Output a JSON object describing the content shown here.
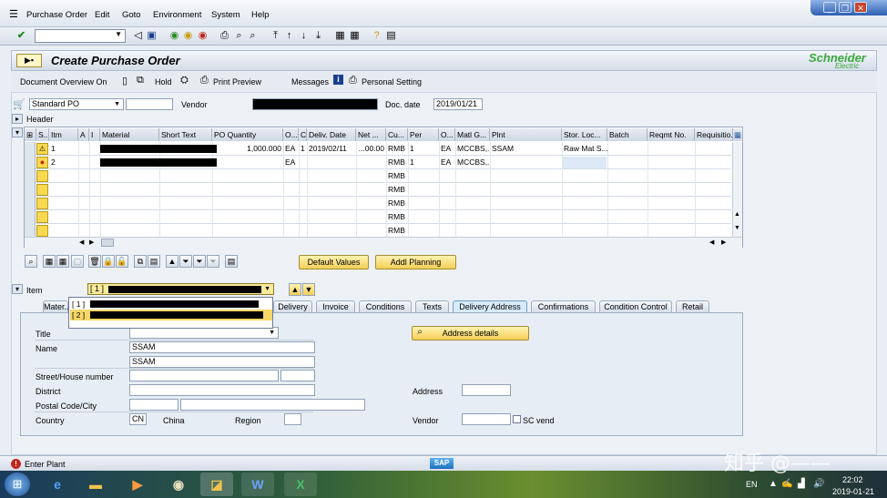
{
  "menu": {
    "items": [
      "Purchase Order",
      "Edit",
      "Goto",
      "Environment",
      "System",
      "Help"
    ]
  },
  "title": "Create Purchase Order",
  "brand": {
    "top": "Schneider",
    "bottom": "Electric"
  },
  "app_toolbar": {
    "doc_overview": "Document Overview On",
    "hold": "Hold",
    "print_preview": "Print Preview",
    "messages": "Messages",
    "personal_setting": "Personal Setting"
  },
  "header": {
    "doc_type": "Standard PO",
    "vendor_label": "Vendor",
    "doc_date_label": "Doc. date",
    "doc_date": "2019/01/21",
    "header_label": "Header"
  },
  "grid": {
    "columns": [
      "S..",
      "Itm",
      "A",
      "I",
      "Material",
      "Short Text",
      "PO Quantity",
      "O...",
      "C",
      "Deliv. Date",
      "Net ...",
      "Cu...",
      "Per",
      "O...",
      "Matl G...",
      "Plnt",
      "Stor. Loc...",
      "Batch",
      "Reqmt No.",
      "Requisitio..."
    ],
    "rows": [
      {
        "status": "warning",
        "itm": "1",
        "qty": "1,000.000",
        "unit": "EA",
        "c": "1",
        "date": "2019/02/11",
        "net": "...00.00",
        "cur": "RMB",
        "per": "1",
        "oun": "EA",
        "matlg": "MCCBS,...",
        "plnt": "SSAM",
        "sloc": "Raw Mat S..."
      },
      {
        "status": "error",
        "itm": "2",
        "qty": "",
        "unit": "EA",
        "c": "",
        "date": "",
        "net": "",
        "cur": "RMB",
        "per": "1",
        "oun": "EA",
        "matlg": "MCCBS,...",
        "plnt": "",
        "sloc": ""
      },
      {
        "status": "",
        "itm": "",
        "qty": "",
        "unit": "",
        "c": "",
        "date": "",
        "net": "",
        "cur": "RMB",
        "per": "",
        "oun": "",
        "matlg": "",
        "plnt": "",
        "sloc": ""
      },
      {
        "status": "",
        "itm": "",
        "qty": "",
        "unit": "",
        "c": "",
        "date": "",
        "net": "",
        "cur": "RMB",
        "per": "",
        "oun": "",
        "matlg": "",
        "plnt": "",
        "sloc": ""
      },
      {
        "status": "",
        "itm": "",
        "qty": "",
        "unit": "",
        "c": "",
        "date": "",
        "net": "",
        "cur": "RMB",
        "per": "",
        "oun": "",
        "matlg": "",
        "plnt": "",
        "sloc": ""
      },
      {
        "status": "",
        "itm": "",
        "qty": "",
        "unit": "",
        "c": "",
        "date": "",
        "net": "",
        "cur": "RMB",
        "per": "",
        "oun": "",
        "matlg": "",
        "plnt": "",
        "sloc": ""
      },
      {
        "status": "",
        "itm": "",
        "qty": "",
        "unit": "",
        "c": "",
        "date": "",
        "net": "",
        "cur": "RMB",
        "per": "",
        "oun": "",
        "matlg": "",
        "plnt": "",
        "sloc": ""
      }
    ]
  },
  "buttons": {
    "default_values": "Default Values",
    "addl_planning": "Addl Planning",
    "address_details": "Address details"
  },
  "item": {
    "label": "Item",
    "selected": "[ 1 ]"
  },
  "dropdown": {
    "options": [
      "[ 1 ]",
      "[ 2 ]"
    ]
  },
  "tabs": [
    "Mater...",
    "Delivery",
    "Invoice",
    "Conditions",
    "Texts",
    "Delivery Address",
    "Confirmations",
    "Condition Control",
    "Retail"
  ],
  "address": {
    "title_label": "Title",
    "name_label": "Name",
    "name1": "SSAM",
    "name2": "SSAM",
    "street_label": "Street/House number",
    "district_label": "District",
    "postal_label": "Postal Code/City",
    "country_label": "Country",
    "country_code": "CN",
    "country_name": "China",
    "region_label": "Region",
    "address_label": "Address",
    "vendor_label": "Vendor",
    "sc_vend": "SC vend"
  },
  "status": {
    "message": "Enter Plant",
    "sap": "SAP"
  },
  "taskbar": {
    "lang": "EN",
    "time": "22:02",
    "date": "2019-01-21",
    "watermark": "知乎 @——"
  }
}
